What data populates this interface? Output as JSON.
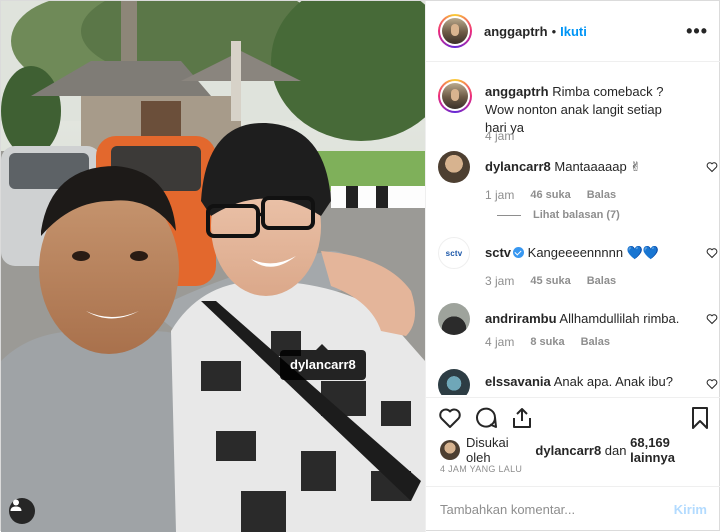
{
  "post": {
    "author": "anggaptrh",
    "separator": "•",
    "follow_label": "Ikuti",
    "more_label": "•••",
    "photo_tag": "dylancarr8"
  },
  "caption": {
    "user": "anggaptrh",
    "text": "Rimba comeback ? Wow nonton anak langit setiap hari ya",
    "time": "4 jam"
  },
  "comments": [
    {
      "user": "dylancarr8",
      "verified": false,
      "text": "Mantaaaaap ✌",
      "time": "1 jam",
      "likes": "46 suka",
      "reply": "Balas",
      "view_replies": "Lihat balasan (7)"
    },
    {
      "user": "sctv",
      "verified": true,
      "text": "Kangeeeennnnn 💙💙",
      "time": "3 jam",
      "likes": "45 suka",
      "reply": "Balas"
    },
    {
      "user": "andrirambu",
      "verified": false,
      "text": "Allhamdullilah rimba.",
      "time": "4 jam",
      "likes": "8 suka",
      "reply": "Balas"
    },
    {
      "user": "elssavania",
      "verified": false,
      "text": "Anak apa. Anak ibu?"
    }
  ],
  "likes_line": {
    "prefix": "Disukai oleh",
    "user": "dylancarr8",
    "mid": "dan",
    "count": "68,169 lainnya"
  },
  "timestamp": "4 JAM YANG LALU",
  "composer": {
    "placeholder": "Tambahkan komentar...",
    "post_label": "Kirim"
  },
  "icons": [
    "more-icon",
    "heart-icon",
    "comment-icon",
    "share-icon",
    "bookmark-icon",
    "user-tag-icon",
    "verified-icon"
  ],
  "colors": {
    "accent": "#0095f6",
    "muted": "#8e8e8e",
    "text": "#262626",
    "border": "#efefef",
    "verified": "#3897f0"
  }
}
